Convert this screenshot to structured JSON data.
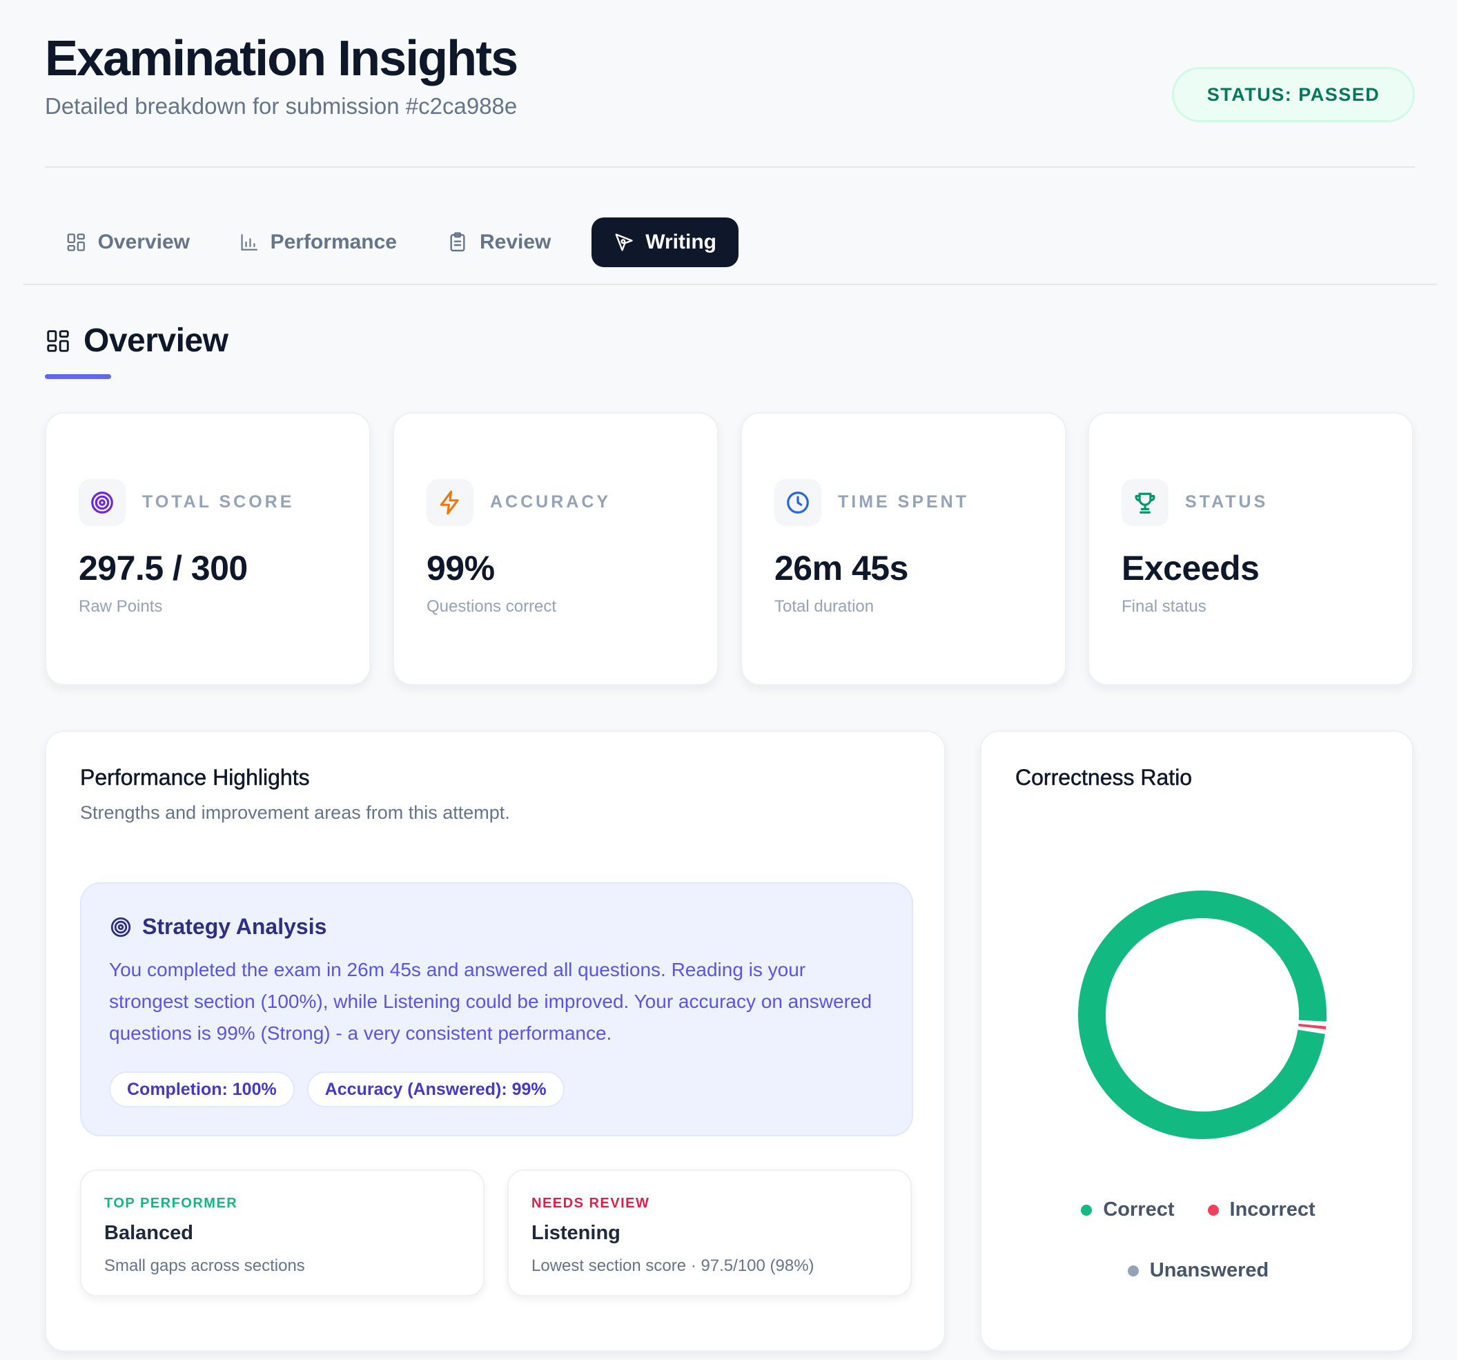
{
  "header": {
    "title": "Examination Insights",
    "subtitle": "Detailed breakdown for submission #c2ca988e",
    "status_pill": "STATUS: PASSED"
  },
  "tabs": [
    {
      "label": "Overview",
      "icon": "grid-icon",
      "active": false
    },
    {
      "label": "Performance",
      "icon": "bar-chart-icon",
      "active": false
    },
    {
      "label": "Review",
      "icon": "clipboard-icon",
      "active": false
    },
    {
      "label": "Writing",
      "icon": "pen-tool-icon",
      "active": true
    }
  ],
  "section": {
    "title": "Overview",
    "icon": "grid-icon",
    "accent": "#6366f1"
  },
  "stats": [
    {
      "label": "TOTAL SCORE",
      "value": "297.5 / 300",
      "caption": "Raw Points",
      "icon": "target-icon",
      "icon_color": "#6d28d9"
    },
    {
      "label": "ACCURACY",
      "value": "99%",
      "caption": "Questions correct",
      "icon": "lightning-icon",
      "icon_color": "#ea7a0c"
    },
    {
      "label": "TIME SPENT",
      "value": "26m 45s",
      "caption": "Total duration",
      "icon": "clock-icon",
      "icon_color": "#2563eb"
    },
    {
      "label": "STATUS",
      "value": "Exceeds",
      "caption": "Final status",
      "icon": "trophy-icon",
      "icon_color": "#059669"
    }
  ],
  "highlights": {
    "title": "Performance Highlights",
    "subtitle": "Strengths and improvement areas from this attempt.",
    "strategy": {
      "title": "Strategy Analysis",
      "icon": "target-icon",
      "text": "You completed the exam in 26m 45s and answered all questions. Reading is your strongest section (100%), while Listening could be improved. Your accuracy on answered questions is 99% (Strong) - a very consistent performance.",
      "chips": [
        "Completion: 100%",
        "Accuracy (Answered): 99%"
      ]
    },
    "top": {
      "kicker": "TOP PERFORMER",
      "title": "Balanced",
      "desc": "Small gaps across sections",
      "color": "#10b981"
    },
    "review": {
      "kicker": "NEEDS REVIEW",
      "title": "Listening",
      "desc": "Lowest section score · 97.5/100 (98%)",
      "color": "#e11d48"
    }
  },
  "chart_data": {
    "type": "pie",
    "title": "Correctness Ratio",
    "series": [
      {
        "name": "Correct",
        "value": 99,
        "color": "#12b981"
      },
      {
        "name": "Incorrect",
        "value": 1,
        "color": "#f43f5e"
      },
      {
        "name": "Unanswered",
        "value": 0,
        "color": "#94a3b8"
      }
    ],
    "legend_position": "bottom"
  }
}
